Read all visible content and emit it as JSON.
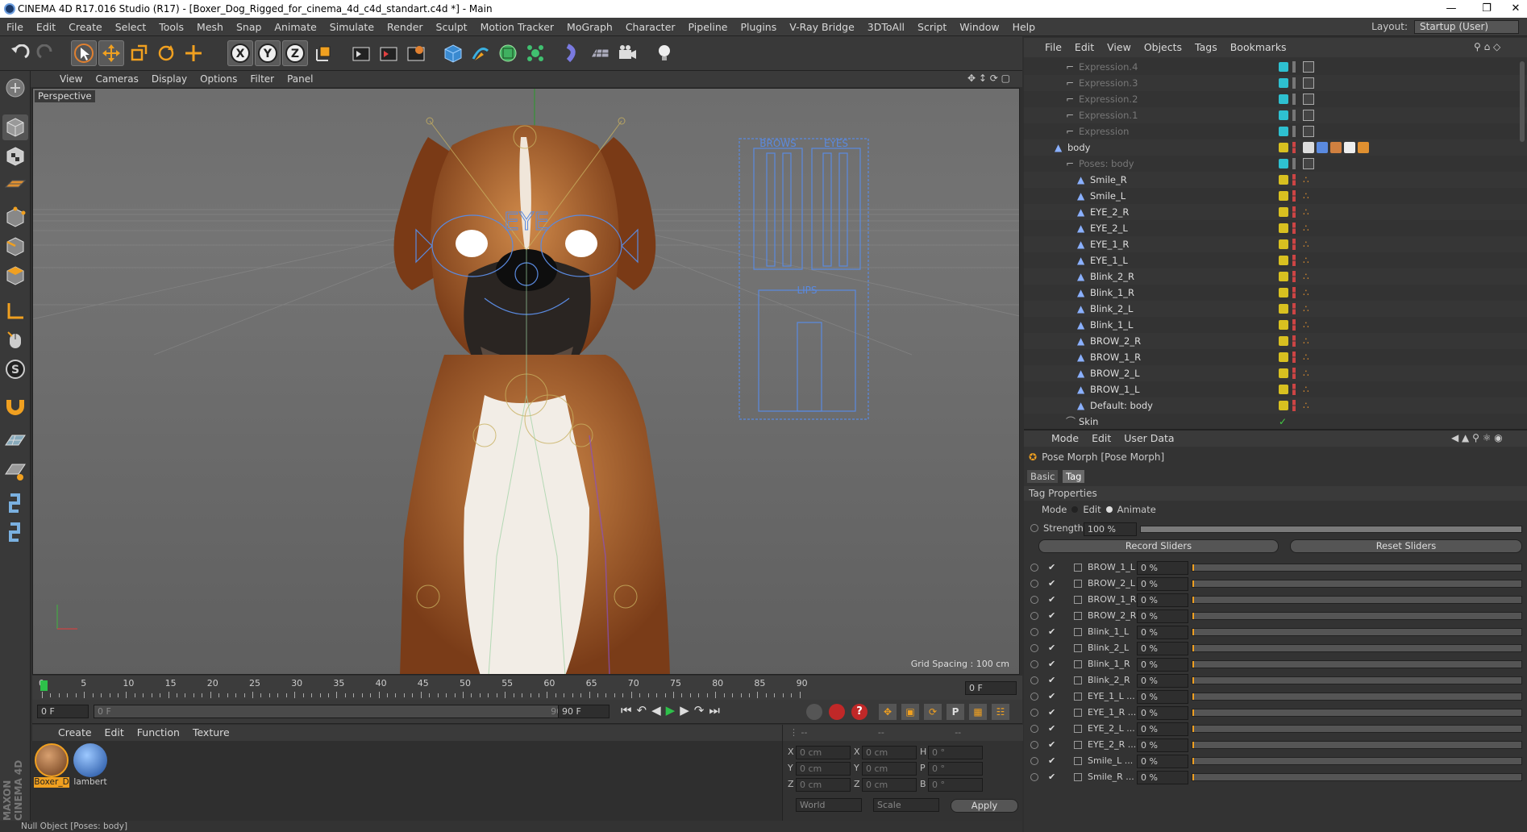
{
  "window": {
    "title": "CINEMA 4D R17.016 Studio (R17) - [Boxer_Dog_Rigged_for_cinema_4d_c4d_standart.c4d *] - Main"
  },
  "menubar": {
    "items": [
      "File",
      "Edit",
      "Create",
      "Select",
      "Tools",
      "Mesh",
      "Snap",
      "Animate",
      "Simulate",
      "Render",
      "Sculpt",
      "Motion Tracker",
      "MoGraph",
      "Character",
      "Pipeline",
      "Plugins",
      "V-Ray Bridge",
      "3DToAll",
      "Script",
      "Window",
      "Help"
    ],
    "layout_label": "Layout:",
    "layout_value": "Startup (User)"
  },
  "viewport": {
    "menu": [
      "View",
      "Cameras",
      "Display",
      "Options",
      "Filter",
      "Panel"
    ],
    "label": "Perspective",
    "grid_spacing": "Grid Spacing : 100 cm",
    "rig_labels": {
      "eye": "EYE",
      "brows": "BROWS",
      "eyes": "EYES",
      "lips": "LIPS"
    }
  },
  "timeline": {
    "ticks": [
      "0",
      "5",
      "10",
      "15",
      "20",
      "25",
      "30",
      "35",
      "40",
      "45",
      "50",
      "55",
      "60",
      "65",
      "70",
      "75",
      "80",
      "85",
      "90"
    ],
    "current_frame": "0 F"
  },
  "playbar": {
    "start": "0 F",
    "range_start": "0 F",
    "range_end": "90 F",
    "end": "90 F"
  },
  "material_manager": {
    "menu": [
      "Create",
      "Edit",
      "Function",
      "Texture"
    ],
    "materials": [
      {
        "name": "Boxer_D"
      },
      {
        "name": "lambert"
      }
    ]
  },
  "coords": {
    "rows": [
      {
        "a": "X",
        "av": "0 cm",
        "b": "X",
        "bv": "0 cm",
        "c": "H",
        "cv": "0 °"
      },
      {
        "a": "Y",
        "av": "0 cm",
        "b": "Y",
        "bv": "0 cm",
        "c": "P",
        "cv": "0 °"
      },
      {
        "a": "Z",
        "av": "0 cm",
        "b": "Z",
        "bv": "0 cm",
        "c": "B",
        "cv": "0 °"
      }
    ],
    "mode_world": "World",
    "mode_scale": "Scale",
    "apply": "Apply"
  },
  "statusbar": {
    "text": "Null Object [Poses: body]"
  },
  "object_manager": {
    "menu": [
      "File",
      "Edit",
      "View",
      "Objects",
      "Tags",
      "Bookmarks"
    ],
    "rows": [
      {
        "name": "Expression.4",
        "dim": true
      },
      {
        "name": "Expression.3",
        "dim": true
      },
      {
        "name": "Expression.2",
        "dim": true
      },
      {
        "name": "Expression.1",
        "dim": true
      },
      {
        "name": "Expression",
        "dim": true
      },
      {
        "name": "body",
        "dim": false
      },
      {
        "name": "Poses: body",
        "dim": true
      },
      {
        "name": "Smile_R",
        "dim": false
      },
      {
        "name": "Smile_L",
        "dim": false
      },
      {
        "name": "EYE_2_R",
        "dim": false
      },
      {
        "name": "EYE_2_L",
        "dim": false
      },
      {
        "name": "EYE_1_R",
        "dim": false
      },
      {
        "name": "EYE_1_L",
        "dim": false
      },
      {
        "name": "Blink_2_R",
        "dim": false
      },
      {
        "name": "Blink_1_R",
        "dim": false
      },
      {
        "name": "Blink_2_L",
        "dim": false
      },
      {
        "name": "Blink_1_L",
        "dim": false
      },
      {
        "name": "BROW_2_R",
        "dim": false
      },
      {
        "name": "BROW_1_R",
        "dim": false
      },
      {
        "name": "BROW_2_L",
        "dim": false
      },
      {
        "name": "BROW_1_L",
        "dim": false
      },
      {
        "name": "Default: body",
        "dim": false
      },
      {
        "name": "Skin",
        "dim": false
      }
    ]
  },
  "attributes": {
    "menu": [
      "Mode",
      "Edit",
      "User Data"
    ],
    "title": "Pose Morph [Pose Morph]",
    "tabs": [
      "Basic",
      "Tag"
    ],
    "section": "Tag Properties",
    "mode_label": "Mode",
    "mode_edit": "Edit",
    "mode_animate": "Animate",
    "strength_label": "Strength",
    "strength_value": "100 %",
    "strength_fraction": 1.0,
    "record_sliders": "Record Sliders",
    "reset_sliders": "Reset Sliders",
    "sliders": [
      {
        "name": "BROW_1_L",
        "value": "0 %"
      },
      {
        "name": "BROW_2_L",
        "value": "0 %"
      },
      {
        "name": "BROW_1_R",
        "value": "0 %"
      },
      {
        "name": "BROW_2_R",
        "value": "0 %"
      },
      {
        "name": "Blink_1_L",
        "value": "0 %"
      },
      {
        "name": "Blink_2_L",
        "value": "0 %"
      },
      {
        "name": "Blink_1_R",
        "value": "0 %"
      },
      {
        "name": "Blink_2_R",
        "value": "0 %"
      },
      {
        "name": "EYE_1_L ...",
        "value": "0 %"
      },
      {
        "name": "EYE_1_R ...",
        "value": "0 %"
      },
      {
        "name": "EYE_2_L ...",
        "value": "0 %"
      },
      {
        "name": "EYE_2_R ...",
        "value": "0 %"
      },
      {
        "name": "Smile_L ...",
        "value": "0 %"
      },
      {
        "name": "Smile_R ...",
        "value": "0 %"
      }
    ]
  },
  "colors": {
    "accent": "#e0a030",
    "visible_yellow": "#d8c020",
    "teal": "#2ec0d0",
    "rig_blue": "#5a8ae0"
  }
}
